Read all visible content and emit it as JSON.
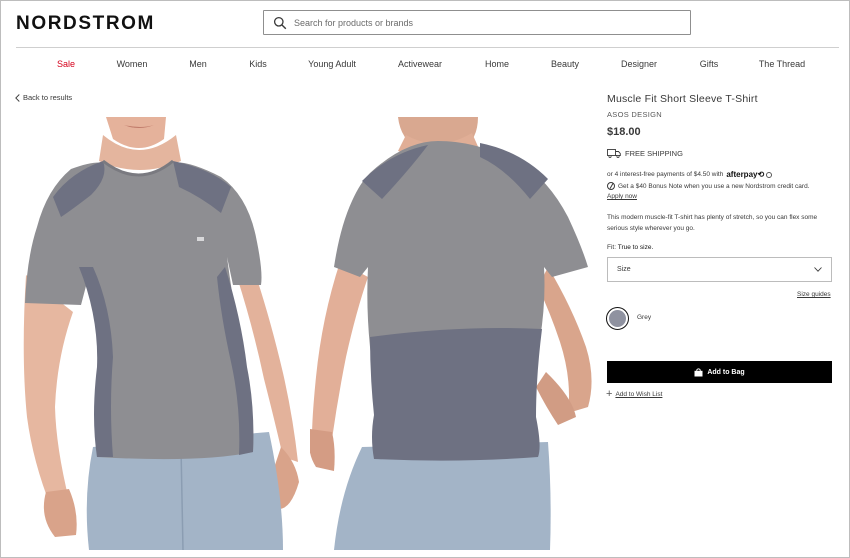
{
  "header": {
    "logo": "NORDSTROM",
    "search_placeholder": "Search for products or brands"
  },
  "nav": {
    "items": [
      "Sale",
      "Women",
      "Men",
      "Kids",
      "Young Adult",
      "Activewear",
      "Home",
      "Beauty",
      "Designer",
      "Gifts",
      "The Thread"
    ]
  },
  "back_link": "Back to results",
  "product": {
    "title": "Muscle Fit Short Sleeve T-Shirt",
    "brand": "ASOS DESIGN",
    "price": "$18.00",
    "shipping": "FREE SHIPPING",
    "installments": "or 4 interest-free payments of $4.50 with",
    "afterpay": "afterpay",
    "bonus_note": "Get a $40 Bonus Note when you use a new Nordstrom credit card.",
    "apply_now": "Apply now",
    "description": "This modern muscle-fit T-shirt has plenty of stretch, so you can flex some serious style wherever you go.",
    "fit_label": "Fit:",
    "fit_value": "True to size.",
    "size_select": "Size",
    "size_guides": "Size guides",
    "color_name": "Grey",
    "add_to_bag": "Add to Bag",
    "add_to_wishlist": "Add to Wish List"
  },
  "colors": {
    "sale": "#d6001c",
    "tshirt_heather": "#8e8e92",
    "tshirt_panel": "#6e7182",
    "shorts": "#a3b4c7",
    "skin": "#e9b9a1",
    "button_bg": "#000000"
  },
  "icons": [
    "search-icon",
    "chevron-left-icon",
    "truck-icon",
    "info-icon",
    "credit-card-icon",
    "chevron-down-icon",
    "bag-icon",
    "plus-icon"
  ]
}
